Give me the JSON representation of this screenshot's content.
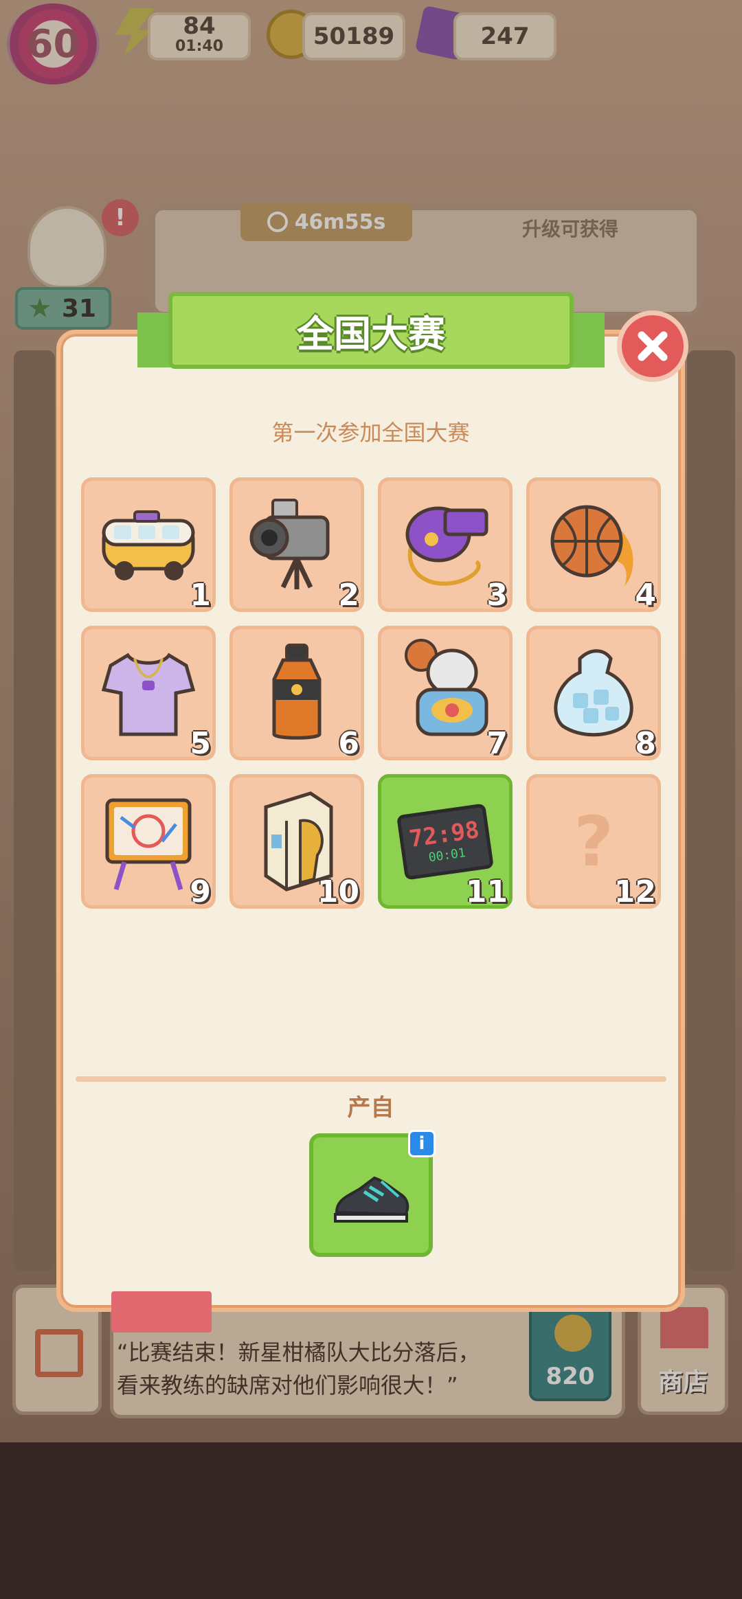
{
  "hud": {
    "level": "60",
    "energy": "84",
    "energy_timer": "01:40",
    "coins": "50189",
    "gems": "247"
  },
  "background": {
    "timer": "46m55s",
    "upgrade_label": "升级可获得",
    "stars": "31",
    "quote_line1": "“比赛结束！新星柑橘队大比分落后，",
    "quote_line2": "看来教练的缺席对他们影响很大！”",
    "cost": "820",
    "shop_label": "商店"
  },
  "modal": {
    "title": "全国大赛",
    "subtitle": "第一次参加全国大赛",
    "source_label": "产自",
    "info_badge": "i",
    "items": [
      {
        "num": "1",
        "icon": "bus-icon"
      },
      {
        "num": "2",
        "icon": "video-camera-icon"
      },
      {
        "num": "3",
        "icon": "whistle-icon"
      },
      {
        "num": "4",
        "icon": "fire-basketball-icon"
      },
      {
        "num": "5",
        "icon": "jersey-shirt-icon"
      },
      {
        "num": "6",
        "icon": "sports-drink-icon"
      },
      {
        "num": "7",
        "icon": "mascot-figure-icon"
      },
      {
        "num": "8",
        "icon": "ice-bag-icon"
      },
      {
        "num": "9",
        "icon": "tactics-board-icon"
      },
      {
        "num": "10",
        "icon": "trophy-box-icon"
      },
      {
        "num": "11",
        "icon": "scoreboard-icon"
      },
      {
        "num": "12",
        "icon": "question-mark-icon"
      }
    ],
    "scoreboard_text": "72:98",
    "scoreboard_time": "00:01",
    "source_icon": "sneaker-icon"
  },
  "colors": {
    "modal_bg": "#f6efe0",
    "cell_bg": "#f5c7a6",
    "active_cell": "#8ed04f",
    "ribbon": "#a7d85c",
    "close": "#e25a5a"
  }
}
